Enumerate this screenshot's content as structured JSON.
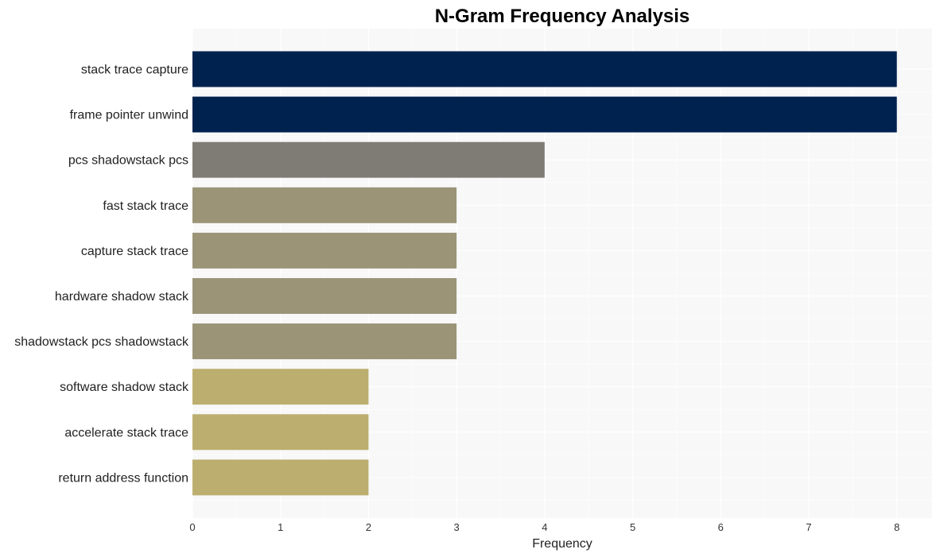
{
  "chart_data": {
    "type": "bar",
    "orientation": "horizontal",
    "title": "N-Gram Frequency Analysis",
    "xlabel": "Frequency",
    "ylabel": "",
    "xlim": [
      0,
      8.4
    ],
    "xticks": [
      0,
      1,
      2,
      3,
      4,
      5,
      6,
      7,
      8
    ],
    "grid": true,
    "categories": [
      "stack trace capture",
      "frame pointer unwind",
      "pcs shadowstack pcs",
      "fast stack trace",
      "capture stack trace",
      "hardware shadow stack",
      "shadowstack pcs shadowstack",
      "software shadow stack",
      "accelerate stack trace",
      "return address function"
    ],
    "values": [
      8,
      8,
      4,
      3,
      3,
      3,
      3,
      2,
      2,
      2
    ],
    "colors": [
      "#00224e",
      "#00224e",
      "#7f7c76",
      "#9b9477",
      "#9b9477",
      "#9b9477",
      "#9b9477",
      "#bcae6f",
      "#bcae6f",
      "#bcae6f"
    ],
    "background": "#f8f8f8"
  }
}
